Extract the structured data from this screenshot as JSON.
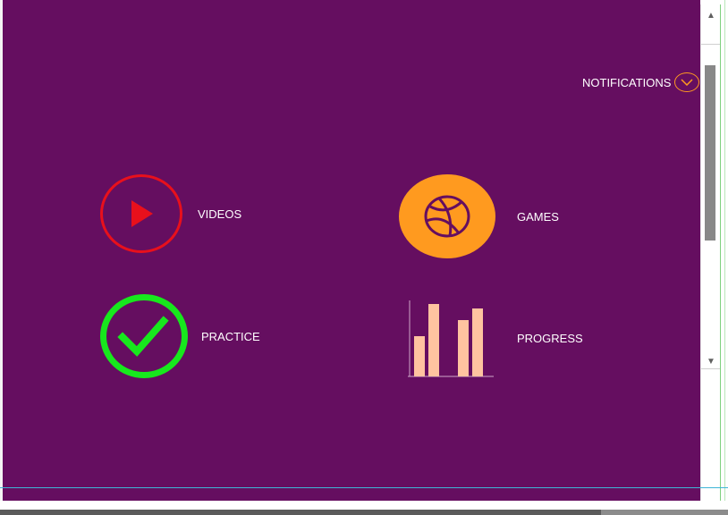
{
  "header": {
    "notifications_label": "NOTIFICATIONS"
  },
  "menu": {
    "videos_label": "VIDEOS",
    "games_label": "GAMES",
    "practice_label": "PRACTICE",
    "progress_label": "PROGRESS"
  },
  "icons": {
    "videos": "play-icon",
    "games": "basketball-icon",
    "practice": "checkmark-icon",
    "progress": "bar-chart-icon",
    "notifications": "chevron-down-icon"
  },
  "colors": {
    "background": "#650e60",
    "videos_accent": "#e8101c",
    "games_accent": "#ff9a1f",
    "practice_accent": "#17e81d",
    "progress_bars": "#ffc3a0"
  }
}
